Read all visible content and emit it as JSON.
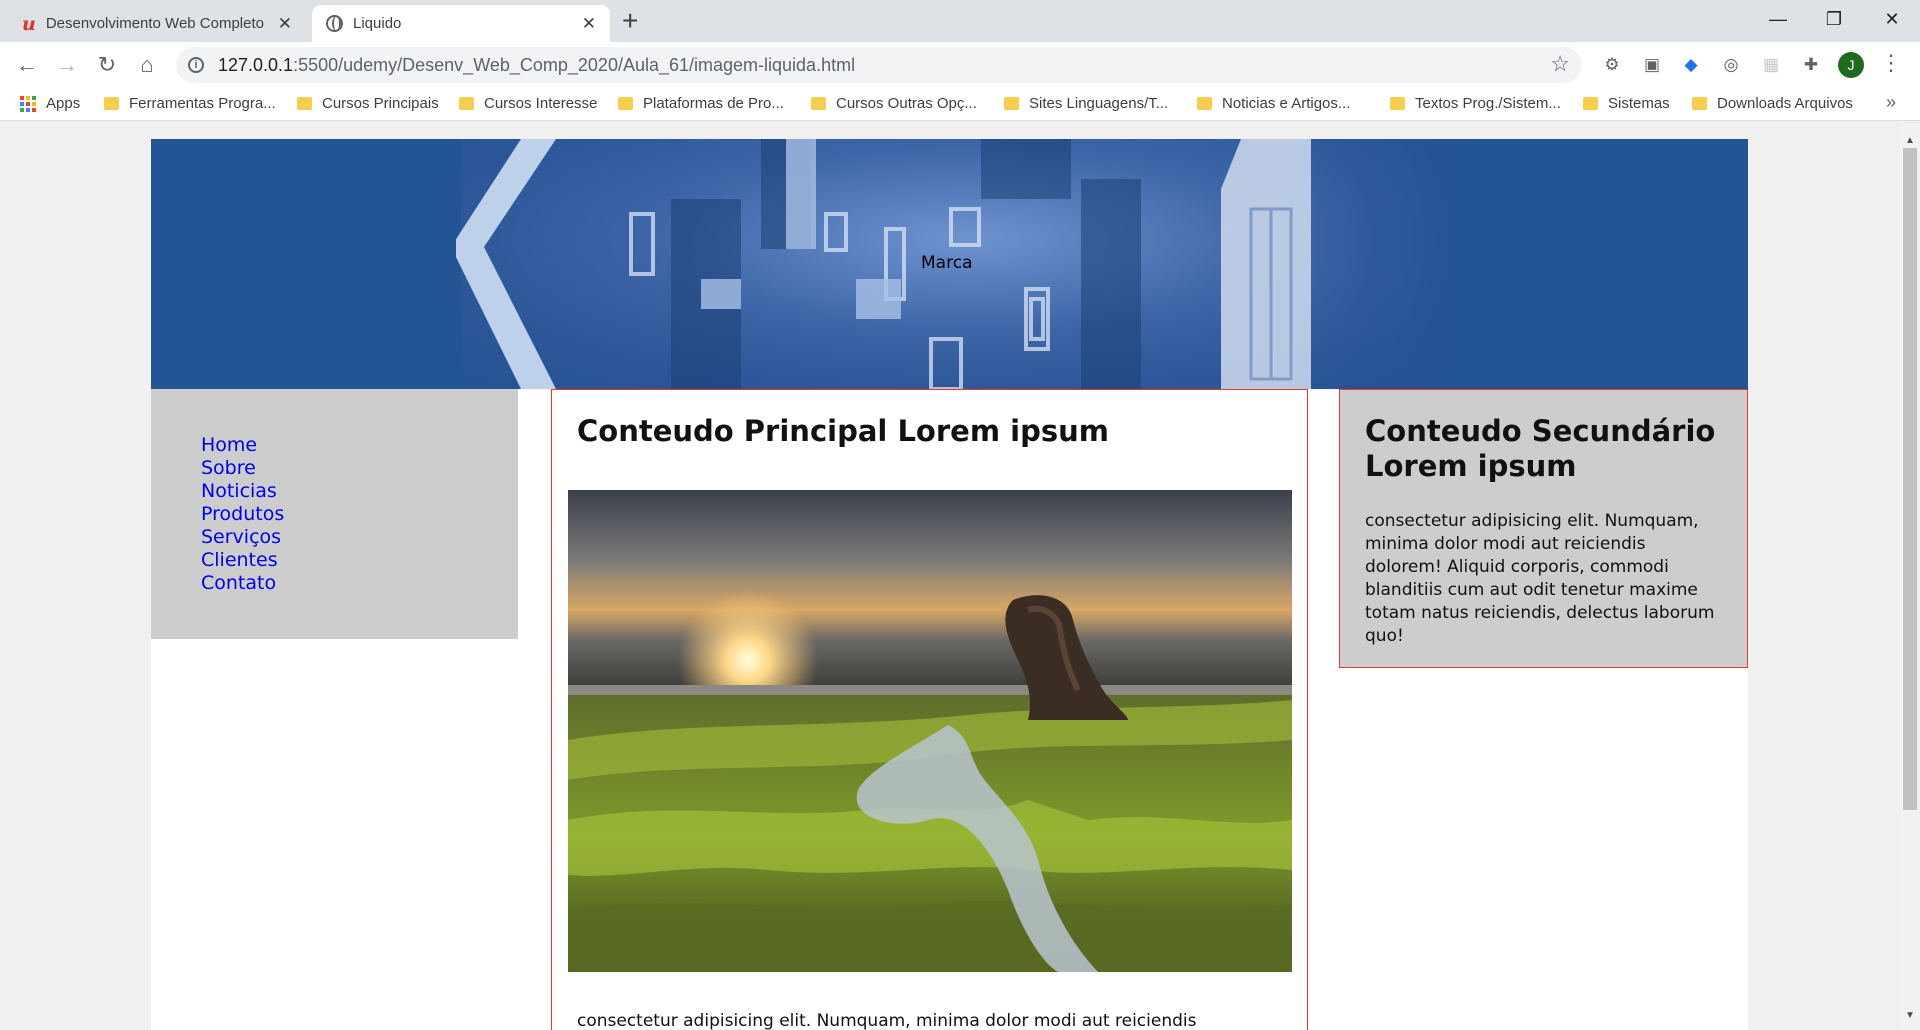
{
  "browser": {
    "tabs": [
      {
        "title": "Desenvolvimento Web Completo",
        "active": false
      },
      {
        "title": "Liquido",
        "active": true
      }
    ],
    "new_tab": "+",
    "window": {
      "minimize": "—",
      "maximize": "❐",
      "close": "✕"
    },
    "url_host": "127.0.0.1",
    "url_path": ":5500/udemy/Desenv_Web_Comp_2020/Aula_61/imagem-liquida.html",
    "avatar_letter": "J",
    "bookmarks": [
      "Apps",
      "Ferramentas Progra...",
      "Cursos Principais",
      "Cursos Interesse",
      "Plataformas de Pro...",
      "Cursos Outras Opç...",
      "Sites Linguagens/T...",
      "Noticias e Artigos...",
      "Textos Prog./Sistem...",
      "Sistemas",
      "Downloads Arquivos"
    ],
    "bookmarks_more": "»"
  },
  "page": {
    "brand": "Marca",
    "menu": [
      "Home",
      "Sobre",
      "Noticias",
      "Produtos",
      "Serviços",
      "Clientes",
      "Contato"
    ],
    "main_title": "Conteudo Principal Lorem ipsum",
    "main_text": "consectetur adipisicing elit. Numquam, minima dolor modi aut reiciendis",
    "aside_title": "Conteudo Secundário Lorem ipsum",
    "aside_text": "consectetur adipisicing elit. Numquam, minima dolor modi aut reiciendis dolorem! Aliquid corporis, commodi blanditiis cum aut odit tenetur maxime totam natus reiciendis, delectus laborum quo!"
  },
  "colors": {
    "banner": "#235493",
    "sidebar": "#cdcdcd",
    "link": "#0000ee",
    "border": "#ee3333"
  }
}
